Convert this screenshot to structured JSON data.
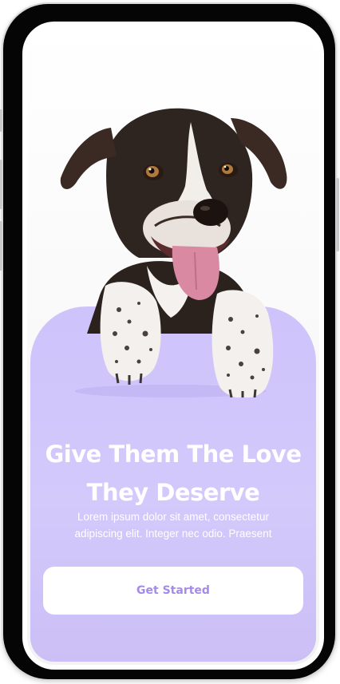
{
  "onboarding": {
    "headline_line1": "Give Them The Love",
    "headline_line2": "They Deserve",
    "description_line1": "Lorem ipsum dolor sit amet, consectetur",
    "description_line2": "adipiscing elit. Integer nec odio. Praesent",
    "cta_label": "Get Started"
  },
  "colors": {
    "card": "#cfc4fb",
    "accent": "#a58ae8",
    "headline": "#ffffff"
  },
  "icons": {
    "hero": "dog-illustration"
  }
}
